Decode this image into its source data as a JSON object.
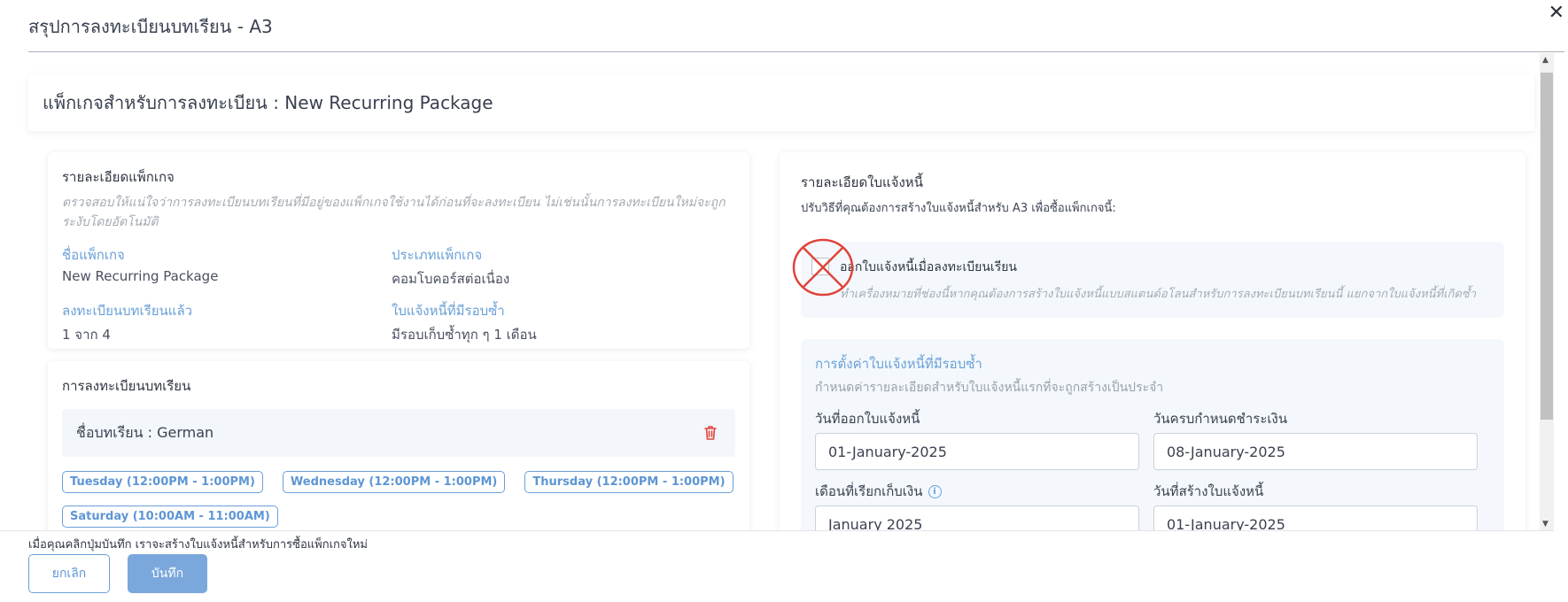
{
  "modal": {
    "title": "สรุปการลงทะเบียนบทเรียน - A3",
    "close_icon": "close-icon"
  },
  "package_header": {
    "text": "แพ็กเกจสำหรับการลงทะเบียน : New Recurring Package"
  },
  "package_details": {
    "title": "รายละเอียดแพ็กเกจ",
    "note": "ตรวจสอบให้แน่ใจว่าการลงทะเบียนบทเรียนที่มีอยู่ของแพ็กเกจใช้งานได้ก่อนที่จะลงทะเบียน ไม่เช่นนั้นการลงทะเบียนใหม่จะถูกระงับโดยอัตโนมัติ",
    "fields": [
      {
        "label": "ชื่อแพ็กเกจ",
        "value": "New Recurring Package"
      },
      {
        "label": "ประเภทแพ็กเกจ",
        "value": "คอมโบคอร์สต่อเนื่อง"
      },
      {
        "label": "ลงทะเบียนบทเรียนแล้ว",
        "value": "1 จาก 4"
      },
      {
        "label": "ใบแจ้งหนี้ที่มีรอบซ้ำ",
        "value": "มีรอบเก็บซ้ำทุก ๆ 1 เดือน"
      }
    ]
  },
  "course_enrollment": {
    "title": "การลงทะเบียนบทเรียน",
    "course_name": "ชื่อบทเรียน : German",
    "schedules": [
      "Tuesday (12:00PM - 1:00PM)",
      "Wednesday (12:00PM - 1:00PM)",
      "Thursday (12:00PM - 1:00PM)",
      "Saturday (10:00AM - 11:00AM)"
    ]
  },
  "invoice": {
    "title": "รายละเอียดใบแจ้งหนี้",
    "subtitle": "ปรับวิธีที่คุณต้องการสร้างใบแจ้งหนี้สำหรับ A3 เพื่อซื้อแพ็กเกจนี้:",
    "option_label": "ออกใบแจ้งหนี้เมื่อลงทะเบียนเรียน",
    "option_note": "ทำเครื่องหมายที่ช่องนี้หากคุณต้องการสร้างใบแจ้งหนี้แบบสแตนด์อโลนสำหรับการลงทะเบียนบทเรียนนี้ แยกจากใบแจ้งหนี้ที่เกิดซ้ำ",
    "option_checked": false,
    "recurring": {
      "title": "การตั้งค่าใบแจ้งหนี้ที่มีรอบซ้ำ",
      "subtitle": "กำหนดค่ารายละเอียดสำหรับใบแจ้งหนี้แรกที่จะถูกสร้างเป็นประจำ",
      "fields": [
        {
          "label": "วันที่ออกใบแจ้งหนี้",
          "value": "01-January-2025"
        },
        {
          "label": "วันครบกำหนดชำระเงิน",
          "value": "08-January-2025"
        },
        {
          "label": "เดือนที่เรียกเก็บเงิน",
          "value": "January 2025",
          "info": "i"
        },
        {
          "label": "วันที่สร้างใบแจ้งหนี้",
          "value": "01-January-2025"
        }
      ]
    }
  },
  "footer": {
    "note": "เมื่อคุณคลิกปุ่มบันทึก เราจะสร้างใบแจ้งหนี้สำหรับการซื้อแพ็กเกจใหม่",
    "cancel_label": "ยกเลิก",
    "save_label": "บันทึก"
  },
  "colors": {
    "accent": "#6aa0d8",
    "save_button": "#7aa7dc",
    "danger": "#e0443a"
  }
}
